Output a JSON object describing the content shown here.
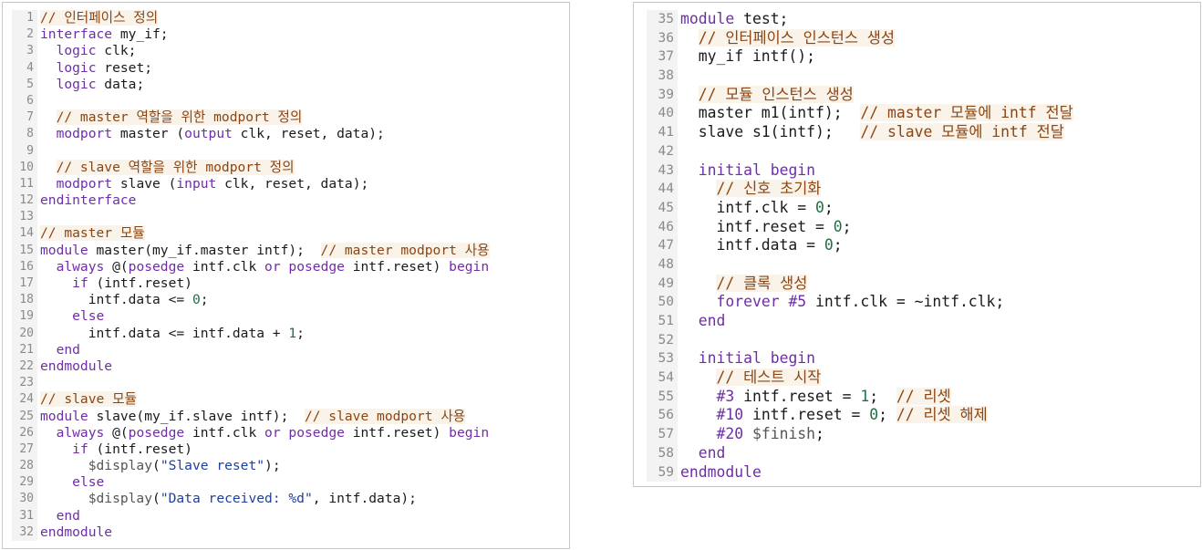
{
  "colors": {
    "keyword": "#6f2da8",
    "comment": "#8b4513",
    "comment_bg": "#faf3ea",
    "number": "#1f6f43",
    "string": "#1f3f9b",
    "system": "#555555",
    "gutter_bg": "#f3f3f3",
    "line_number": "#8a8a8a",
    "border": "#c8c8c8"
  },
  "left_panel": {
    "lines": [
      {
        "n": "1",
        "tokens": [
          [
            "cm",
            "// 인터페이스 정의"
          ]
        ]
      },
      {
        "n": "2",
        "tokens": [
          [
            "kw",
            "interface"
          ],
          [
            "id",
            " my_if;"
          ]
        ]
      },
      {
        "n": "3",
        "tokens": [
          [
            "id",
            "  "
          ],
          [
            "kw",
            "logic"
          ],
          [
            "id",
            " clk;"
          ]
        ]
      },
      {
        "n": "4",
        "tokens": [
          [
            "id",
            "  "
          ],
          [
            "kw",
            "logic"
          ],
          [
            "id",
            " reset;"
          ]
        ]
      },
      {
        "n": "5",
        "tokens": [
          [
            "id",
            "  "
          ],
          [
            "kw",
            "logic"
          ],
          [
            "id",
            " data;"
          ]
        ]
      },
      {
        "n": "6",
        "tokens": []
      },
      {
        "n": "7",
        "tokens": [
          [
            "id",
            "  "
          ],
          [
            "cm",
            "// master 역할을 위한 modport 정의"
          ]
        ]
      },
      {
        "n": "8",
        "tokens": [
          [
            "id",
            "  "
          ],
          [
            "kw",
            "modport"
          ],
          [
            "id",
            " master ("
          ],
          [
            "kw",
            "output"
          ],
          [
            "id",
            " clk, reset, data);"
          ]
        ]
      },
      {
        "n": "9",
        "tokens": []
      },
      {
        "n": "10",
        "tokens": [
          [
            "id",
            "  "
          ],
          [
            "cm",
            "// slave 역할을 위한 modport 정의"
          ]
        ]
      },
      {
        "n": "11",
        "tokens": [
          [
            "id",
            "  "
          ],
          [
            "kw",
            "modport"
          ],
          [
            "id",
            " slave ("
          ],
          [
            "kw",
            "input"
          ],
          [
            "id",
            " clk, reset, data);"
          ]
        ]
      },
      {
        "n": "12",
        "tokens": [
          [
            "kw",
            "endinterface"
          ]
        ]
      },
      {
        "n": "13",
        "tokens": []
      },
      {
        "n": "14",
        "tokens": [
          [
            "cm",
            "// master 모듈"
          ]
        ]
      },
      {
        "n": "15",
        "tokens": [
          [
            "kw",
            "module"
          ],
          [
            "id",
            " master(my_if.master intf);  "
          ],
          [
            "cm",
            "// master modport 사용"
          ]
        ]
      },
      {
        "n": "16",
        "tokens": [
          [
            "id",
            "  "
          ],
          [
            "kw",
            "always"
          ],
          [
            "id",
            " @("
          ],
          [
            "kw",
            "posedge"
          ],
          [
            "id",
            " intf.clk "
          ],
          [
            "kw",
            "or"
          ],
          [
            "id",
            " "
          ],
          [
            "kw",
            "posedge"
          ],
          [
            "id",
            " intf.reset) "
          ],
          [
            "kw",
            "begin"
          ]
        ]
      },
      {
        "n": "17",
        "tokens": [
          [
            "id",
            "    "
          ],
          [
            "kw",
            "if"
          ],
          [
            "id",
            " (intf.reset)"
          ]
        ]
      },
      {
        "n": "18",
        "tokens": [
          [
            "id",
            "      intf.data <= "
          ],
          [
            "num",
            "0"
          ],
          [
            "id",
            ";"
          ]
        ]
      },
      {
        "n": "19",
        "tokens": [
          [
            "id",
            "    "
          ],
          [
            "kw",
            "else"
          ]
        ]
      },
      {
        "n": "20",
        "tokens": [
          [
            "id",
            "      intf.data <= intf.data + "
          ],
          [
            "num",
            "1"
          ],
          [
            "id",
            ";"
          ]
        ]
      },
      {
        "n": "21",
        "tokens": [
          [
            "id",
            "  "
          ],
          [
            "kw",
            "end"
          ]
        ]
      },
      {
        "n": "22",
        "tokens": [
          [
            "kw",
            "endmodule"
          ]
        ]
      },
      {
        "n": "23",
        "tokens": []
      },
      {
        "n": "24",
        "tokens": [
          [
            "cm",
            "// slave 모듈"
          ]
        ]
      },
      {
        "n": "25",
        "tokens": [
          [
            "kw",
            "module"
          ],
          [
            "id",
            " slave(my_if.slave intf);  "
          ],
          [
            "cm",
            "// slave modport 사용"
          ]
        ]
      },
      {
        "n": "26",
        "tokens": [
          [
            "id",
            "  "
          ],
          [
            "kw",
            "always"
          ],
          [
            "id",
            " @("
          ],
          [
            "kw",
            "posedge"
          ],
          [
            "id",
            " intf.clk "
          ],
          [
            "kw",
            "or"
          ],
          [
            "id",
            " "
          ],
          [
            "kw",
            "posedge"
          ],
          [
            "id",
            " intf.reset) "
          ],
          [
            "kw",
            "begin"
          ]
        ]
      },
      {
        "n": "27",
        "tokens": [
          [
            "id",
            "    "
          ],
          [
            "kw",
            "if"
          ],
          [
            "id",
            " (intf.reset)"
          ]
        ]
      },
      {
        "n": "28",
        "tokens": [
          [
            "id",
            "      "
          ],
          [
            "sys",
            "$display"
          ],
          [
            "id",
            "("
          ],
          [
            "str",
            "\"Slave reset\""
          ],
          [
            "id",
            ");"
          ]
        ]
      },
      {
        "n": "29",
        "tokens": [
          [
            "id",
            "    "
          ],
          [
            "kw",
            "else"
          ]
        ]
      },
      {
        "n": "30",
        "tokens": [
          [
            "id",
            "      "
          ],
          [
            "sys",
            "$display"
          ],
          [
            "id",
            "("
          ],
          [
            "str",
            "\"Data received: %d\""
          ],
          [
            "id",
            ", intf.data);"
          ]
        ]
      },
      {
        "n": "31",
        "tokens": [
          [
            "id",
            "  "
          ],
          [
            "kw",
            "end"
          ]
        ]
      },
      {
        "n": "32",
        "tokens": [
          [
            "kw",
            "endmodule"
          ]
        ]
      }
    ]
  },
  "right_panel": {
    "lines": [
      {
        "n": "35",
        "tokens": [
          [
            "kw",
            "module"
          ],
          [
            "id",
            " test;"
          ]
        ]
      },
      {
        "n": "36",
        "tokens": [
          [
            "id",
            "  "
          ],
          [
            "cm",
            "// 인터페이스 인스턴스 생성"
          ]
        ]
      },
      {
        "n": "37",
        "tokens": [
          [
            "id",
            "  my_if intf();"
          ]
        ]
      },
      {
        "n": "38",
        "tokens": []
      },
      {
        "n": "39",
        "tokens": [
          [
            "id",
            "  "
          ],
          [
            "cm",
            "// 모듈 인스턴스 생성"
          ]
        ]
      },
      {
        "n": "40",
        "tokens": [
          [
            "id",
            "  master m1(intf);  "
          ],
          [
            "cm",
            "// master 모듈에 intf 전달"
          ]
        ]
      },
      {
        "n": "41",
        "tokens": [
          [
            "id",
            "  slave s1(intf);   "
          ],
          [
            "cm",
            "// slave 모듈에 intf 전달"
          ]
        ]
      },
      {
        "n": "42",
        "tokens": []
      },
      {
        "n": "43",
        "tokens": [
          [
            "id",
            "  "
          ],
          [
            "kw",
            "initial"
          ],
          [
            "id",
            " "
          ],
          [
            "kw",
            "begin"
          ]
        ]
      },
      {
        "n": "44",
        "tokens": [
          [
            "id",
            "    "
          ],
          [
            "cm",
            "// 신호 초기화"
          ]
        ]
      },
      {
        "n": "45",
        "tokens": [
          [
            "id",
            "    intf.clk = "
          ],
          [
            "num",
            "0"
          ],
          [
            "id",
            ";"
          ]
        ]
      },
      {
        "n": "46",
        "tokens": [
          [
            "id",
            "    intf.reset = "
          ],
          [
            "num",
            "0"
          ],
          [
            "id",
            ";"
          ]
        ]
      },
      {
        "n": "47",
        "tokens": [
          [
            "id",
            "    intf.data = "
          ],
          [
            "num",
            "0"
          ],
          [
            "id",
            ";"
          ]
        ]
      },
      {
        "n": "48",
        "tokens": []
      },
      {
        "n": "49",
        "tokens": [
          [
            "id",
            "    "
          ],
          [
            "cm",
            "// 클록 생성"
          ]
        ]
      },
      {
        "n": "50",
        "tokens": [
          [
            "id",
            "    "
          ],
          [
            "kw",
            "forever"
          ],
          [
            "id",
            " "
          ],
          [
            "kw",
            "#5"
          ],
          [
            "id",
            " intf.clk = ~intf.clk;"
          ]
        ]
      },
      {
        "n": "51",
        "tokens": [
          [
            "id",
            "  "
          ],
          [
            "kw",
            "end"
          ]
        ]
      },
      {
        "n": "52",
        "tokens": []
      },
      {
        "n": "53",
        "tokens": [
          [
            "id",
            "  "
          ],
          [
            "kw",
            "initial"
          ],
          [
            "id",
            " "
          ],
          [
            "kw",
            "begin"
          ]
        ]
      },
      {
        "n": "54",
        "tokens": [
          [
            "id",
            "    "
          ],
          [
            "cm",
            "// 테스트 시작"
          ]
        ]
      },
      {
        "n": "55",
        "tokens": [
          [
            "id",
            "    "
          ],
          [
            "kw",
            "#3"
          ],
          [
            "id",
            " intf.reset = "
          ],
          [
            "num",
            "1"
          ],
          [
            "id",
            ";  "
          ],
          [
            "cm",
            "// 리셋"
          ]
        ]
      },
      {
        "n": "56",
        "tokens": [
          [
            "id",
            "    "
          ],
          [
            "kw",
            "#10"
          ],
          [
            "id",
            " intf.reset = "
          ],
          [
            "num",
            "0"
          ],
          [
            "id",
            "; "
          ],
          [
            "cm",
            "// 리셋 해제"
          ]
        ]
      },
      {
        "n": "57",
        "tokens": [
          [
            "id",
            "    "
          ],
          [
            "kw",
            "#20"
          ],
          [
            "id",
            " "
          ],
          [
            "sys",
            "$finish"
          ],
          [
            "id",
            ";"
          ]
        ]
      },
      {
        "n": "58",
        "tokens": [
          [
            "id",
            "  "
          ],
          [
            "kw",
            "end"
          ]
        ]
      },
      {
        "n": "59",
        "tokens": [
          [
            "kw",
            "endmodule"
          ]
        ]
      }
    ]
  }
}
